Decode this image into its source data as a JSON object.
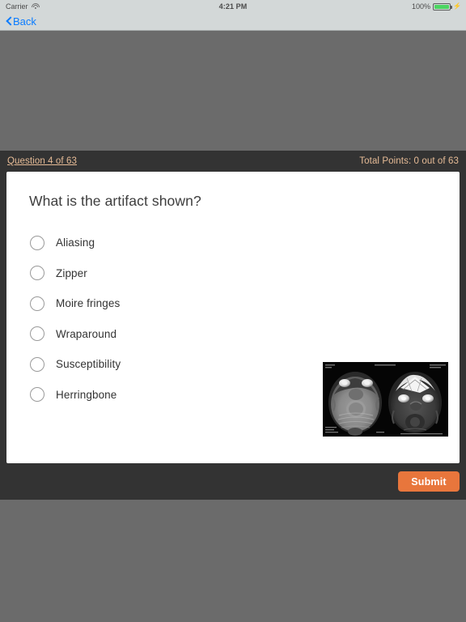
{
  "statusbar": {
    "carrier": "Carrier",
    "wifi_icon": "wifi-icon",
    "time": "4:21 PM",
    "battery_percent": "100%",
    "battery_icon": "battery-full-icon",
    "charging_icon": "charging-bolt-icon"
  },
  "navbar": {
    "back_label": "Back",
    "back_chevron_icon": "chevron-left-icon"
  },
  "quiz": {
    "counter": "Question 4 of 63",
    "points": "Total Points: 0 out of 63",
    "question": "What is the artifact shown?",
    "options": [
      {
        "label": "Aliasing"
      },
      {
        "label": "Zipper"
      },
      {
        "label": "Moire fringes"
      },
      {
        "label": "Wraparound"
      },
      {
        "label": "Susceptibility"
      },
      {
        "label": "Herringbone"
      }
    ],
    "figure": {
      "name": "mri-artifact-image",
      "description": "Two axial brain MRI slices side by side"
    },
    "submit_label": "Submit"
  },
  "colors": {
    "accent_orange": "#e8763c",
    "header_text": "#e6bb96",
    "panel_dark": "#333333",
    "page_background": "#6b6b6b",
    "navbar": "#d3d8d8",
    "link_blue": "#0a7cff",
    "battery_green": "#4cd562"
  }
}
